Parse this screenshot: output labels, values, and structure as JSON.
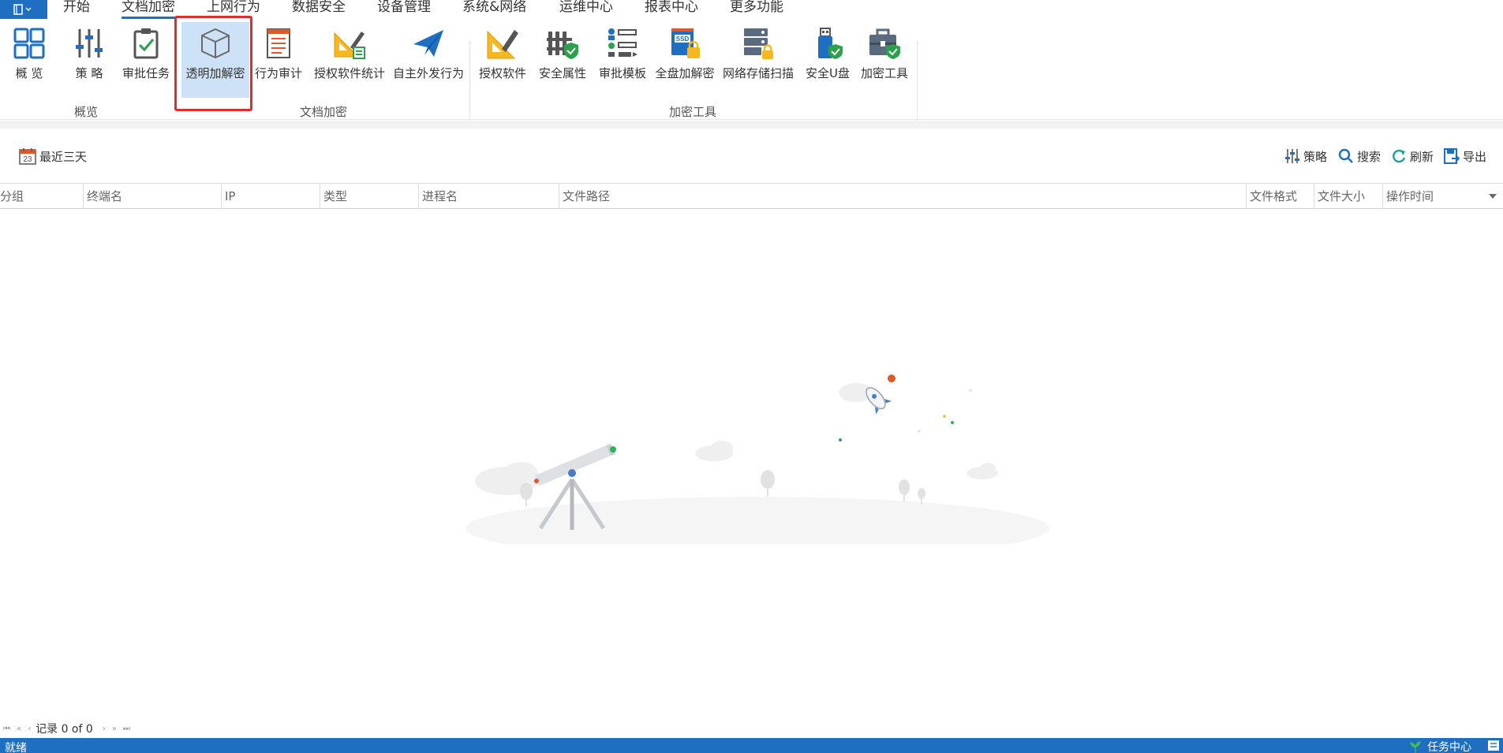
{
  "menubar": {
    "tabs": [
      {
        "label": "开始"
      },
      {
        "label": "文档加密",
        "active": true
      },
      {
        "label": "上网行为"
      },
      {
        "label": "数据安全"
      },
      {
        "label": "设备管理"
      },
      {
        "label": "系统&网络"
      },
      {
        "label": "运维中心"
      },
      {
        "label": "报表中心"
      },
      {
        "label": "更多功能"
      }
    ]
  },
  "ribbon": {
    "items": [
      {
        "label": "概 览",
        "icon": "grid-icon"
      },
      {
        "label": "策 略",
        "icon": "sliders-icon"
      },
      {
        "label": "审批任务",
        "icon": "clipboard-check-icon"
      },
      {
        "label": "透明加解密",
        "icon": "cube-icon",
        "selected": true
      },
      {
        "label": "行为审计",
        "icon": "document-list-icon"
      },
      {
        "label": "授权软件统计",
        "icon": "ruler-pencil-chart-icon"
      },
      {
        "label": "自主外发行为",
        "icon": "paper-plane-icon"
      },
      {
        "label": "授权软件",
        "icon": "ruler-pencil-icon"
      },
      {
        "label": "安全属性",
        "icon": "fence-shield-icon"
      },
      {
        "label": "审批模板",
        "icon": "template-list-icon"
      },
      {
        "label": "全盘加解密",
        "icon": "ssd-lock-icon"
      },
      {
        "label": "网络存储扫描",
        "icon": "server-lock-icon"
      },
      {
        "label": "安全U盘",
        "icon": "usb-shield-icon"
      },
      {
        "label": "加密工具",
        "icon": "toolbox-shield-icon"
      }
    ],
    "groups": [
      {
        "label": "概览"
      },
      {
        "label": "文档加密"
      },
      {
        "label": "加密工具"
      }
    ]
  },
  "toolbar": {
    "date_range": "最近三天",
    "calendar_day": "23",
    "policy": "策略",
    "search": "搜索",
    "refresh": "刷新",
    "export": "导出"
  },
  "table": {
    "columns": [
      "分组",
      "终端名",
      "IP",
      "类型",
      "进程名",
      "文件路径",
      "文件格式",
      "文件大小",
      "操作时间"
    ],
    "rows": []
  },
  "pager": {
    "record_text": "记录 0 of 0"
  },
  "statusbar": {
    "left": "就绪",
    "right": "任务中心"
  },
  "colors": {
    "accent": "#1e6fc1",
    "highlight": "#e52a2a",
    "selected_bg": "#cde2f6"
  }
}
